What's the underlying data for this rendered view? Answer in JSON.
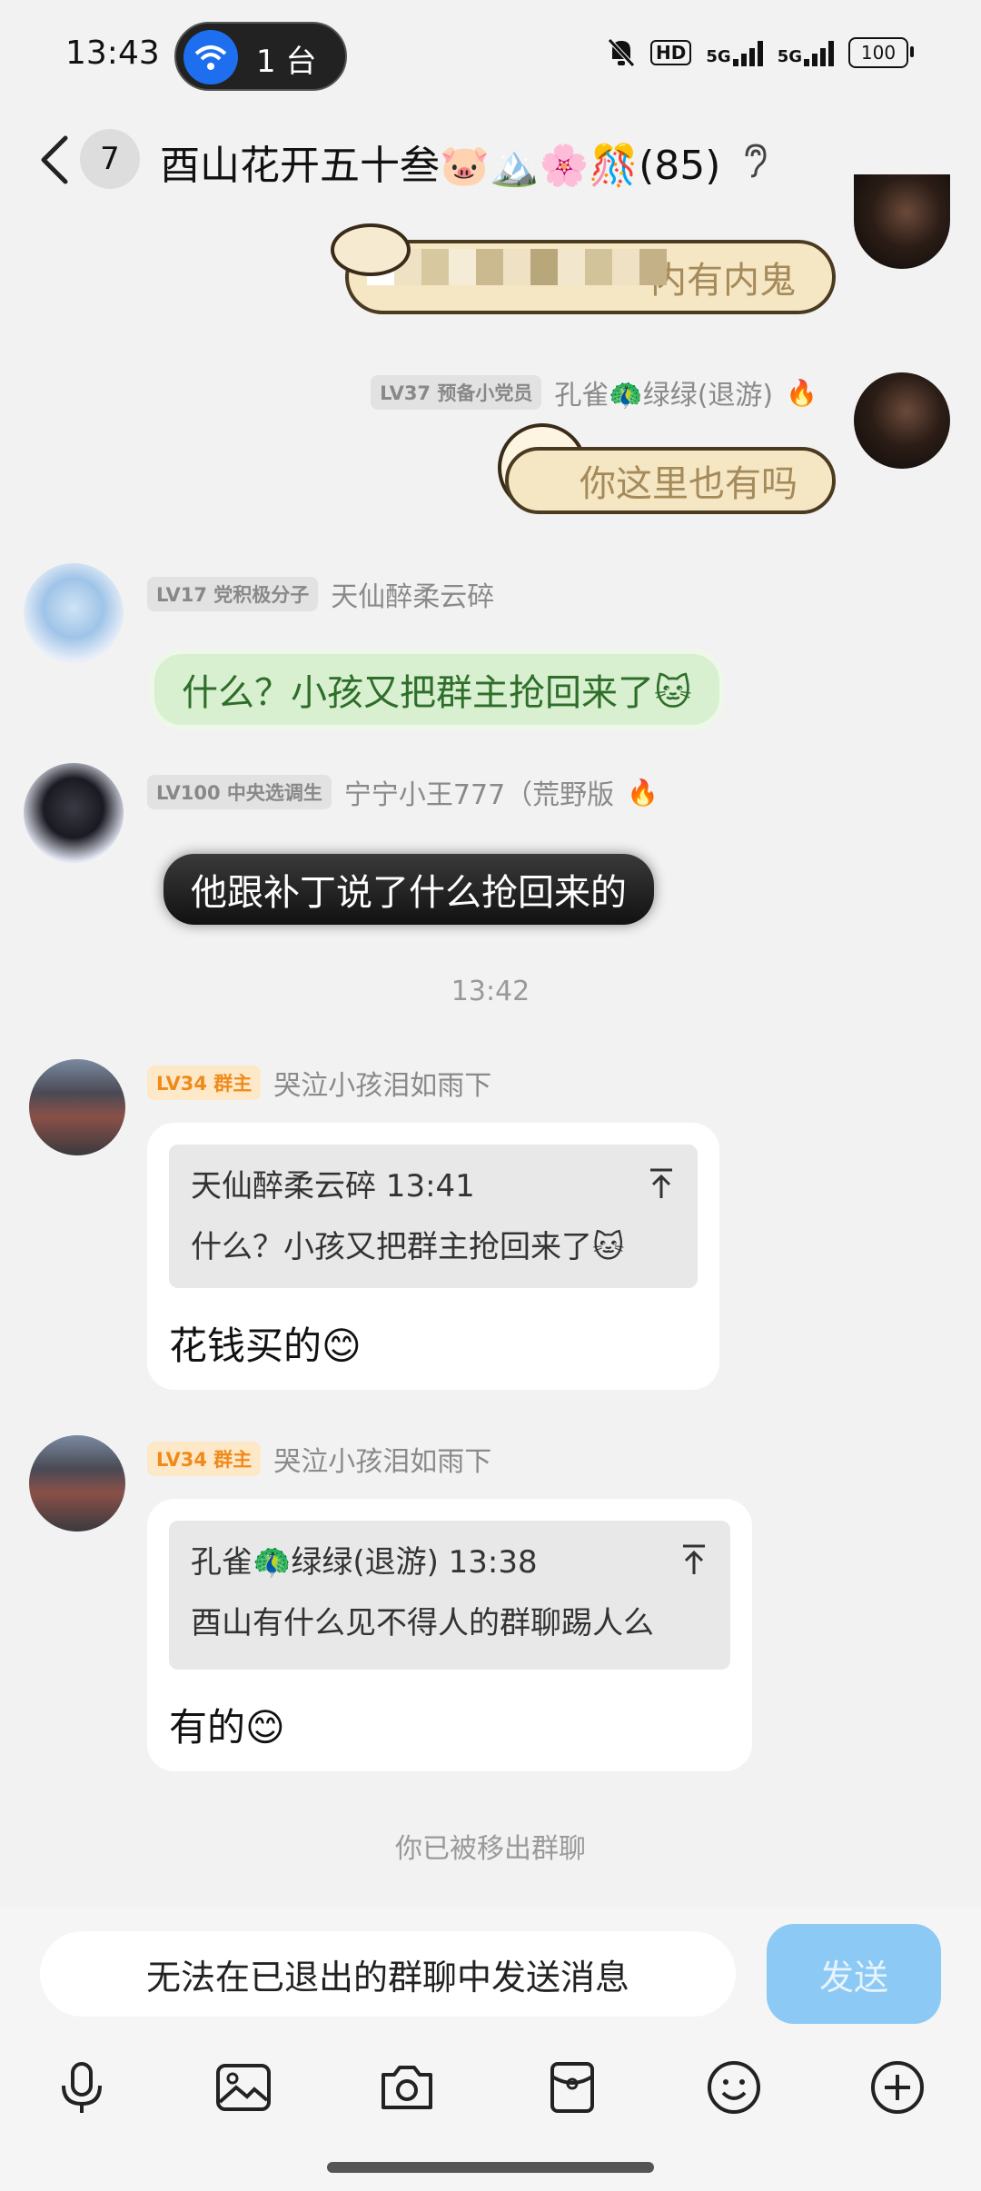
{
  "status_bar": {
    "time": "13:43",
    "cast_label": "1 台",
    "hd_label": "HD",
    "network1": "5G",
    "network2": "5G",
    "battery": "100"
  },
  "header": {
    "unread_count": "7",
    "title": "酉山花开五十叁🐷🏔️🌸🎊(85)"
  },
  "messages": {
    "m1": {
      "text_tail": "内有内鬼"
    },
    "m2": {
      "level": "LV37 预备小党员",
      "name": "孔雀🦚绿绿(退游)",
      "text": "你这里也有吗"
    },
    "m3": {
      "level": "LV17 党积极分子",
      "name": "天仙醉柔云碎",
      "text": "什么？小孩又把群主抢回来了🐱"
    },
    "m4": {
      "level": "LV100 中央选调生",
      "name": "宁宁小王777（荒野版",
      "text": "他跟补丁说了什么抢回来的"
    },
    "timestamp": "13:42",
    "m5": {
      "level": "LV34 群主",
      "name": "哭泣小孩泪如雨下",
      "quote_head": "天仙醉柔云碎 13:41",
      "quote_text": "什么？小孩又把群主抢回来了🐱",
      "reply": "花钱买的😊"
    },
    "m6": {
      "level": "LV34 群主",
      "name": "哭泣小孩泪如雨下",
      "quote_head": "孔雀🦚绿绿(退游) 13:38",
      "quote_text": "酉山有什么见不得人的群聊踢人么",
      "reply": "有的😊"
    },
    "system_note": "你已被移出群聊"
  },
  "input": {
    "placeholder": "无法在已退出的群聊中发送消息",
    "send_label": "发送"
  },
  "toolbar": {
    "icons": [
      "microphone-icon",
      "image-icon",
      "camera-icon",
      "red-packet-icon",
      "emoji-icon",
      "plus-icon"
    ]
  }
}
